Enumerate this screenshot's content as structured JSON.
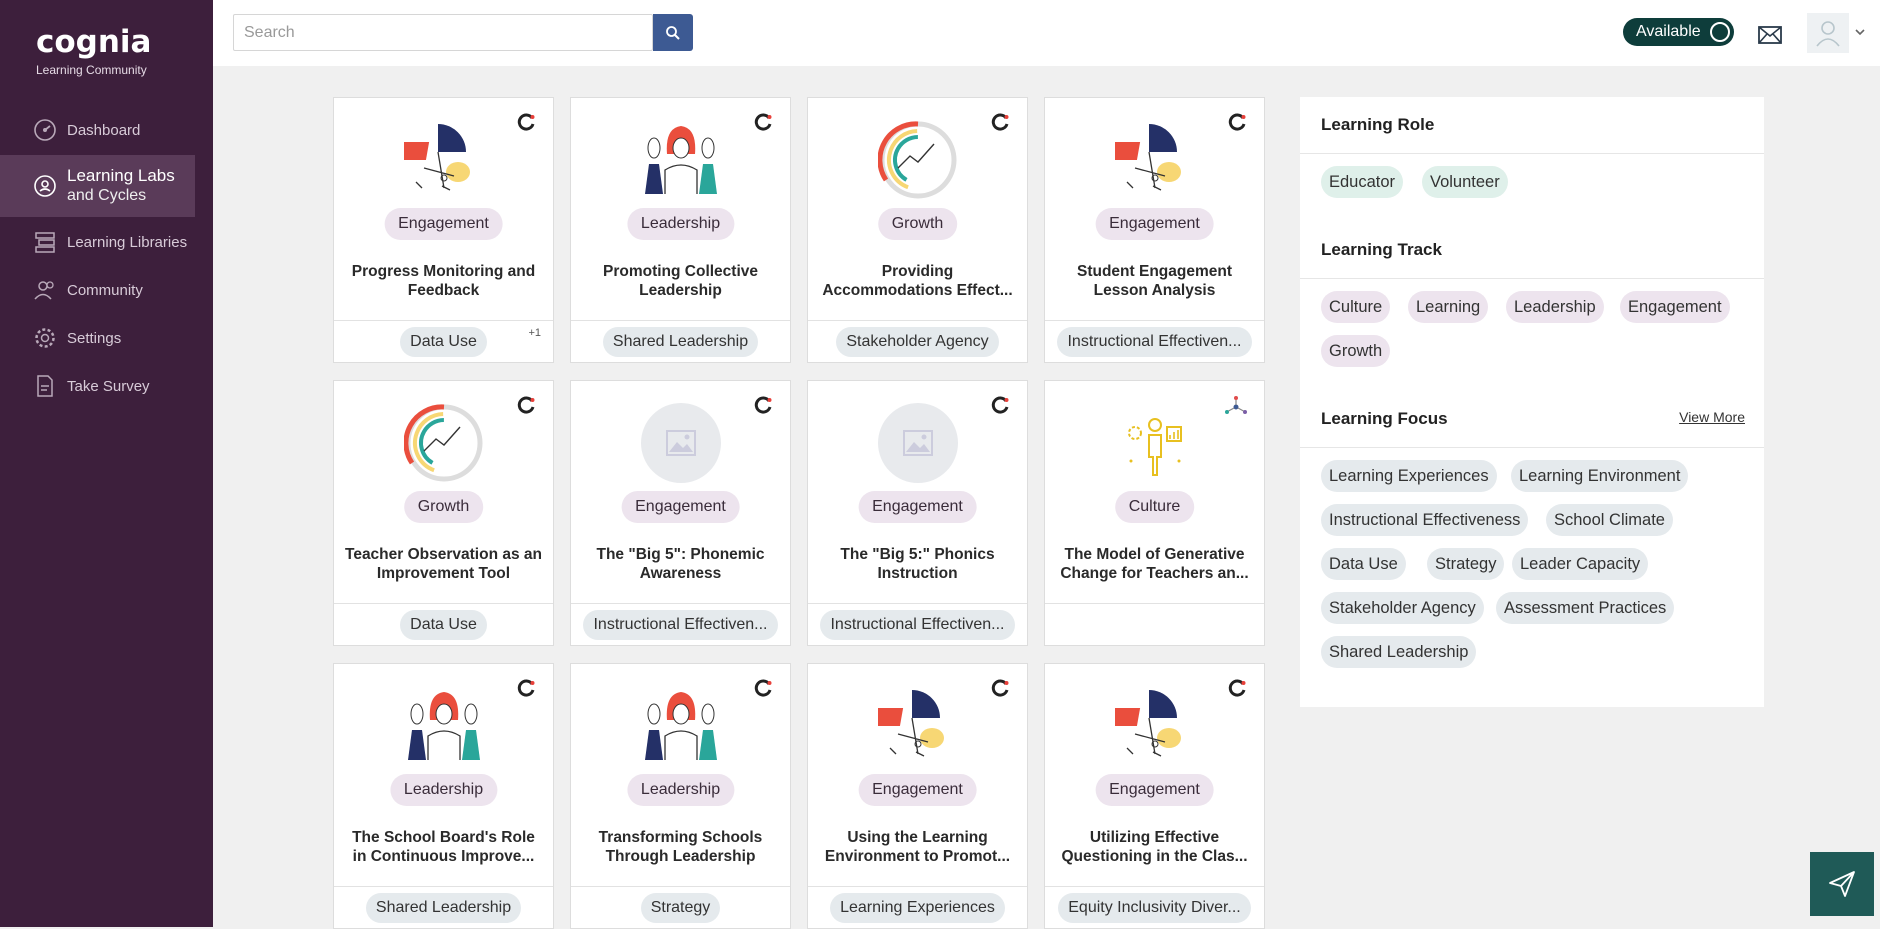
{
  "brand": {
    "logo": "cognia",
    "subtitle": "Learning Community"
  },
  "nav": [
    {
      "label": "Dashboard",
      "icon": "dashboard-icon"
    },
    {
      "label": "Learning Labs",
      "label2": "and Cycles",
      "icon": "learning-labs-icon"
    },
    {
      "label": "Learning Libraries",
      "icon": "libraries-icon"
    },
    {
      "label": "Community",
      "icon": "community-icon"
    },
    {
      "label": "Settings",
      "icon": "gear-icon"
    },
    {
      "label": "Take Survey",
      "icon": "survey-icon"
    }
  ],
  "search": {
    "placeholder": "Search"
  },
  "status": {
    "label": "Available"
  },
  "cards": [
    {
      "track": "Engagement",
      "title": "Progress Monitoring and Feedback",
      "tag": "Data Use",
      "extra": "+1",
      "img": "engagement"
    },
    {
      "track": "Leadership",
      "title": "Promoting Collective Leadership",
      "tag": "Shared Leadership",
      "img": "leadership"
    },
    {
      "track": "Growth",
      "title": "Providing Accommodations Effect...",
      "tag": "Stakeholder Agency",
      "img": "growth"
    },
    {
      "track": "Engagement",
      "title": "Student Engagement Lesson Analysis",
      "tag": "Instructional Effectiven...",
      "img": "engagement"
    },
    {
      "track": "Growth",
      "title": "Teacher Observation as an Improvement Tool",
      "tag": "Data Use",
      "img": "growth"
    },
    {
      "track": "Engagement",
      "title": "The \"Big 5\": Phonemic Awareness",
      "tag": "Instructional Effectiven...",
      "img": "placeholder"
    },
    {
      "track": "Engagement",
      "title": "The \"Big 5:\" Phonics Instruction",
      "tag": "Instructional Effectiven...",
      "img": "placeholder"
    },
    {
      "track": "Culture",
      "title": "The Model of Generative Change for Teachers an...",
      "tag": "",
      "img": "culture"
    },
    {
      "track": "Leadership",
      "title": "The School Board's Role in Continuous Improve...",
      "tag": "Shared Leadership",
      "img": "leadership"
    },
    {
      "track": "Leadership",
      "title": "Transforming Schools Through Leadership",
      "tag": "Strategy",
      "img": "leadership"
    },
    {
      "track": "Engagement",
      "title": "Using the Learning Environment to Promot...",
      "tag": "Learning Experiences",
      "img": "engagement"
    },
    {
      "track": "Engagement",
      "title": "Utilizing Effective Questioning in the Clas...",
      "tag": "Equity Inclusivity Diver...",
      "img": "engagement"
    }
  ],
  "panel": {
    "role_title": "Learning Role",
    "roles": [
      "Educator",
      "Volunteer"
    ],
    "track_title": "Learning Track",
    "tracks": [
      "Culture",
      "Learning",
      "Leadership",
      "Engagement",
      "Growth"
    ],
    "focus_title": "Learning Focus",
    "view_more": "View More",
    "focus": [
      "Learning Experiences",
      "Learning Environment",
      "Instructional Effectiveness",
      "School Climate",
      "Data Use",
      "Strategy",
      "Leader Capacity",
      "Stakeholder Agency",
      "Assessment Practices",
      "Shared Leadership"
    ]
  },
  "colors": {
    "sidebar": "#3d1f3c",
    "accent": "#3d5a93",
    "status": "#0e3d3b"
  }
}
